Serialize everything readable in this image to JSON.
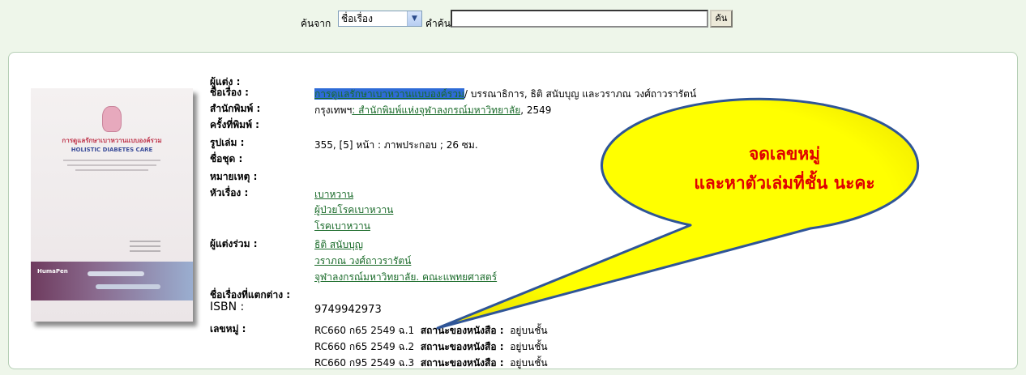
{
  "search": {
    "from_label": "ค้นจาก",
    "field_value": "ชื่อเรื่อง",
    "keyword_label": "คำค้น",
    "keyword_value": "",
    "button_label": "ค้น"
  },
  "book": {
    "fields": {
      "author_label": "ผู้แต่ง :",
      "title_label": "ชื่อเรื่อง :",
      "title_link": "การดูแลรักษาเบาหวานแบบองค์รวม",
      "title_rest": "/ บรรณาธิการ, ธิติ สนับบุญ และวราภณ วงศ์ถาวรารัตน์",
      "publisher_label": "สำนักพิมพ์ :",
      "publisher_place": "กรุงเทพฯ",
      "publisher_link": ": สำนักพิมพ์แห่งจุฬาลงกรณ์มหาวิทยาลัย",
      "publisher_year": ", 2549",
      "edition_label": "ครั้งที่พิมพ์ :",
      "format_label": "รูปเล่ม :",
      "format_value": "355, [5] หน้า : ภาพประกอบ ; 26 ซม.",
      "series_label": "ชื่อชุด :",
      "note_label": "หมายเหตุ :",
      "subject_label": "หัวเรื่อง :",
      "subjects": [
        "เบาหวาน",
        "ผู้ป่วยโรคเบาหวาน",
        "โรคเบาหวาน"
      ],
      "coauthors_label": "ผู้แต่งร่วม :",
      "coauthors": [
        "ธิติ สนับบุญ",
        "วราภณ วงศ์ถาวรารัตน์",
        "จุฬาลงกรณ์มหาวิทยาลัย. คณะแพทยศาสตร์"
      ],
      "variant_title_label": "ชื่อเรื่องที่แตกต่าง :",
      "isbn_label": "ISBN :",
      "isbn_value": "9749942973",
      "callno_label": "เลขหมู่ :"
    },
    "holdings": [
      {
        "call_number": "RC660 ก65 2549 ฉ.1",
        "status_label": "สถานะของหนังสือ :",
        "status": "อยู่บนชั้น"
      },
      {
        "call_number": "RC660 ก65 2549 ฉ.2",
        "status_label": "สถานะของหนังสือ :",
        "status": "อยู่บนชั้น"
      },
      {
        "call_number": "RC660 ก95 2549 ฉ.3",
        "status_label": "สถานะของหนังสือ :",
        "status": "อยู่บนชั้น"
      }
    ],
    "cover": {
      "title_th": "การดูแลรักษาเบาหวานแบบองค์รวม",
      "title_en": "HOLISTIC DIABETES CARE",
      "band_logo": "HumaPen"
    }
  },
  "callout": {
    "line1": "จดเลขหมู่",
    "line2": "และหาตัวเล่มที่ชั้น นะคะ",
    "fill_color": "#ffff00",
    "stroke_color": "#2f5597",
    "text_color": "#e00000"
  }
}
